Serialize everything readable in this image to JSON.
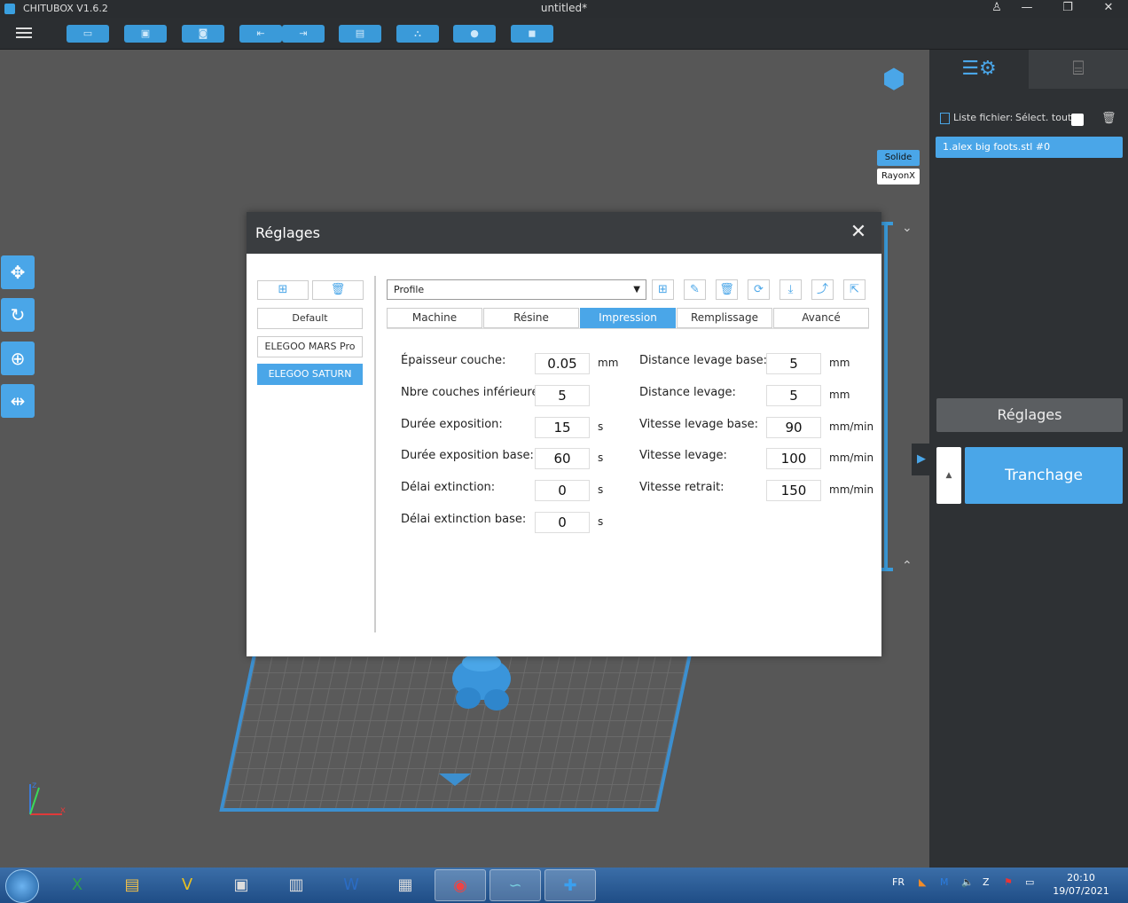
{
  "window": {
    "app_name": "CHITUBOX V1.6.2",
    "title": "untitled*",
    "user_icon": "user-icon",
    "minimize_icon": "minimize-icon",
    "restore_icon": "restore-icon",
    "close_icon": "close-icon"
  },
  "toolbar": {
    "menu_icon": "hamburger-icon",
    "buttons": [
      {
        "name": "open-file-button",
        "icon": "folder-icon",
        "glyph": "▭"
      },
      {
        "name": "save-button",
        "icon": "save-icon",
        "glyph": "▣"
      },
      {
        "name": "screenshot-button",
        "icon": "screenshot-icon",
        "glyph": "◙"
      },
      {
        "name": "undo-button",
        "icon": "undo-icon",
        "glyph": "⇤"
      },
      {
        "name": "redo-button",
        "icon": "redo-icon",
        "glyph": "⇥"
      },
      {
        "name": "layout-button",
        "icon": "layout-icon",
        "glyph": "▤"
      },
      {
        "name": "support-button",
        "icon": "support-icon",
        "glyph": "⛬"
      },
      {
        "name": "hollow-button",
        "icon": "drop-icon",
        "glyph": "●"
      },
      {
        "name": "settings-button",
        "icon": "machine-icon",
        "glyph": "◼"
      }
    ]
  },
  "viewport": {
    "view_modes": {
      "solid": "Solide",
      "xray": "RayonX"
    },
    "left_tools": [
      "move-icon",
      "rotate-icon",
      "scale-icon",
      "mirror-icon"
    ]
  },
  "right_panel": {
    "tabs": [
      "settings-tab-icon",
      "supports-tab-icon"
    ],
    "file_list_label": "Liste fichier:",
    "select_all_label": "Sélect. tout",
    "files": [
      "1.alex big foots.stl #0"
    ],
    "settings_button": "Réglages",
    "slice_button": "Tranchage"
  },
  "dialog": {
    "title": "Réglages",
    "profiles": [
      "Default",
      "ELEGOO MARS Pro",
      "ELEGOO SATURN"
    ],
    "selected_profile_index": 2,
    "profile_select": "Profile",
    "icon_buttons": [
      "new-profile-icon",
      "edit-icon",
      "delete-icon",
      "refresh-icon",
      "import-icon",
      "export-icon",
      "export-all-icon"
    ],
    "tabs": [
      "Machine",
      "Résine",
      "Impression",
      "Remplissage",
      "Avancé"
    ],
    "active_tab": "Impression",
    "left_fields": [
      {
        "label": "Épaisseur couche:",
        "value": "0.05",
        "unit": "mm"
      },
      {
        "label": "Nbre couches inférieures:",
        "value": "5",
        "unit": ""
      },
      {
        "label": "Durée exposition:",
        "value": "15",
        "unit": "s"
      },
      {
        "label": "Durée exposition base:",
        "value": "60",
        "unit": "s"
      },
      {
        "label": "Délai extinction:",
        "value": "0",
        "unit": "s"
      },
      {
        "label": "Délai extinction base:",
        "value": "0",
        "unit": "s"
      }
    ],
    "right_fields": [
      {
        "label": "Distance levage base:",
        "value": "5",
        "unit": "mm"
      },
      {
        "label": "Distance levage:",
        "value": "5",
        "unit": "mm"
      },
      {
        "label": "Vitesse levage base:",
        "value": "90",
        "unit": "mm/min"
      },
      {
        "label": "Vitesse levage:",
        "value": "100",
        "unit": "mm/min"
      },
      {
        "label": "Vitesse retrait:",
        "value": "150",
        "unit": "mm/min"
      }
    ]
  },
  "taskbar": {
    "language": "FR",
    "time": "20:10",
    "date": "19/07/2021",
    "apps": [
      "excel-icon",
      "explorer-icon",
      "vectorworks-icon",
      "app-icon",
      "notes-icon",
      "word-icon",
      "calculator-icon",
      "chrome-icon",
      "chitubox-icon",
      "app-blue-icon"
    ]
  },
  "colors": {
    "accent": "#4aa6e8",
    "dialog_header": "#3a3d40",
    "panel": "#2e3134"
  }
}
